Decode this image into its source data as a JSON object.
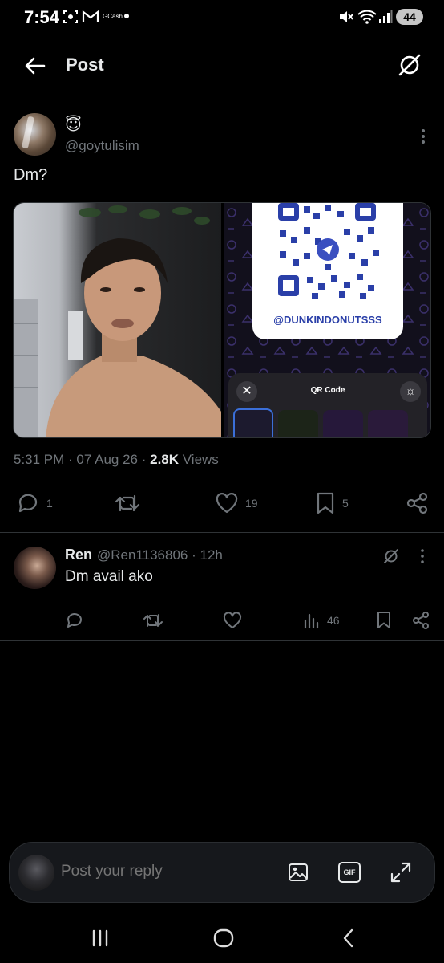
{
  "status_bar": {
    "time": "7:54",
    "gcash_label": "GCash",
    "battery": "44"
  },
  "header": {
    "title": "Post"
  },
  "post": {
    "emoji": "😇",
    "handle": "@goytulisim",
    "text": "Dm?",
    "qr_handle": "@DUNKINDONUTSSS",
    "qr_panel_title": "QR Code",
    "meta": {
      "time": "5:31 PM",
      "date": "07 Aug 26",
      "views_count": "2.8K",
      "views_label": "Views"
    },
    "stats": {
      "replies": "1",
      "likes": "19",
      "bookmarks": "5"
    }
  },
  "reply": {
    "name": "Ren",
    "handle": "@Ren1136806",
    "time": "12h",
    "text": "Dm avail ako",
    "views": "46"
  },
  "reply_bar": {
    "placeholder": "Post your reply",
    "gif_label": "GIF"
  },
  "colors": {
    "background": "#000000",
    "text": "#e7e9ea",
    "secondary": "#71767b",
    "divider": "#2f3336",
    "qr_blue": "#2a3fa8"
  }
}
